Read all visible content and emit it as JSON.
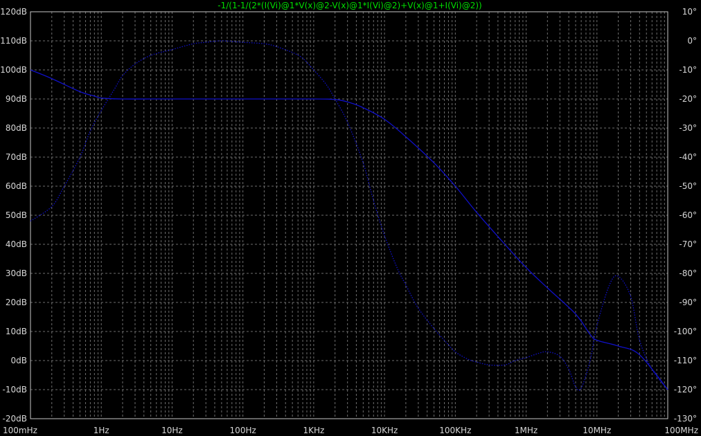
{
  "chart_data": {
    "type": "line",
    "title": "-1/(1-1/(2*(I(Vi)@1*V(x)@2-V(x)@1*I(Vi)@2)+V(x)@1+I(Vi)@2))",
    "title_color": "#00e000",
    "background": "#000000",
    "grid": true,
    "grid_style": "dashed",
    "x_scale": "log",
    "xlim": [
      0.1,
      100000000
    ],
    "xlabel": "",
    "x_tick_labels": [
      "100mHz",
      "1Hz",
      "10Hz",
      "100Hz",
      "1KHz",
      "10KHz",
      "100KHz",
      "1MHz",
      "10MHz",
      "100MHz"
    ],
    "left_axis": {
      "label": "",
      "unit": "dB",
      "range": [
        -20,
        120
      ],
      "tick_labels": [
        "120dB",
        "110dB",
        "100dB",
        "90dB",
        "80dB",
        "70dB",
        "60dB",
        "50dB",
        "40dB",
        "30dB",
        "20dB",
        "10dB",
        "0dB",
        "-10dB",
        "-20dB"
      ]
    },
    "right_axis": {
      "label": "",
      "unit": "°",
      "range": [
        -130,
        10
      ],
      "tick_labels": [
        "10°",
        "0°",
        "-10°",
        "-20°",
        "-30°",
        "-40°",
        "-50°",
        "-60°",
        "-70°",
        "-80°",
        "-90°",
        "-100°",
        "-110°",
        "-120°",
        "-130°"
      ]
    },
    "series": [
      {
        "kind": "magnitude",
        "axis": "left",
        "style": "solid",
        "color": "#1010c8",
        "x": [
          0.1,
          0.2,
          0.5,
          0.8,
          1,
          2,
          5,
          10,
          100,
          1000,
          2000,
          3000,
          5000,
          10000,
          20000,
          50000,
          100000,
          200000,
          500000,
          1000000,
          2000000,
          5000000,
          8000000,
          10000000,
          20000000,
          40000000,
          100000000
        ],
        "y": [
          100,
          97,
          92.5,
          91,
          90.3,
          90,
          90,
          90,
          90,
          90,
          89.8,
          89,
          87,
          83,
          77,
          68,
          60,
          51,
          40,
          32,
          25,
          16,
          9,
          7,
          5,
          2,
          -10
        ]
      },
      {
        "kind": "phase",
        "axis": "right",
        "style": "dotted",
        "color": "#1010c8",
        "x": [
          0.1,
          0.2,
          0.3,
          0.5,
          0.7,
          1,
          1.5,
          2,
          3,
          5,
          10,
          20,
          30,
          50,
          100,
          200,
          300,
          500,
          700,
          1000,
          1500,
          2000,
          3000,
          5000,
          7000,
          10000,
          15000,
          20000,
          30000,
          50000,
          70000,
          100000,
          150000,
          200000,
          300000,
          500000,
          700000,
          1000000,
          1500000,
          2000000,
          3000000,
          4000000,
          5000000,
          6000000,
          8000000,
          10000000,
          15000000,
          20000000,
          30000000,
          40000000,
          60000000,
          100000000
        ],
        "y": [
          -62,
          -57,
          -50,
          -40,
          -31,
          -24,
          -17,
          -12,
          -8,
          -5,
          -3,
          -1,
          -0.5,
          0,
          -0.5,
          -1,
          -2,
          -4,
          -6,
          -10,
          -15,
          -20,
          -28,
          -42,
          -55,
          -67,
          -78,
          -84,
          -92,
          -99,
          -103,
          -107,
          -109.5,
          -110.5,
          -111.5,
          -111.5,
          -110,
          -109,
          -107.5,
          -107,
          -108.5,
          -113,
          -119,
          -119.5,
          -110,
          -98,
          -84,
          -81,
          -88,
          -103,
          -113,
          -120
        ]
      }
    ]
  }
}
